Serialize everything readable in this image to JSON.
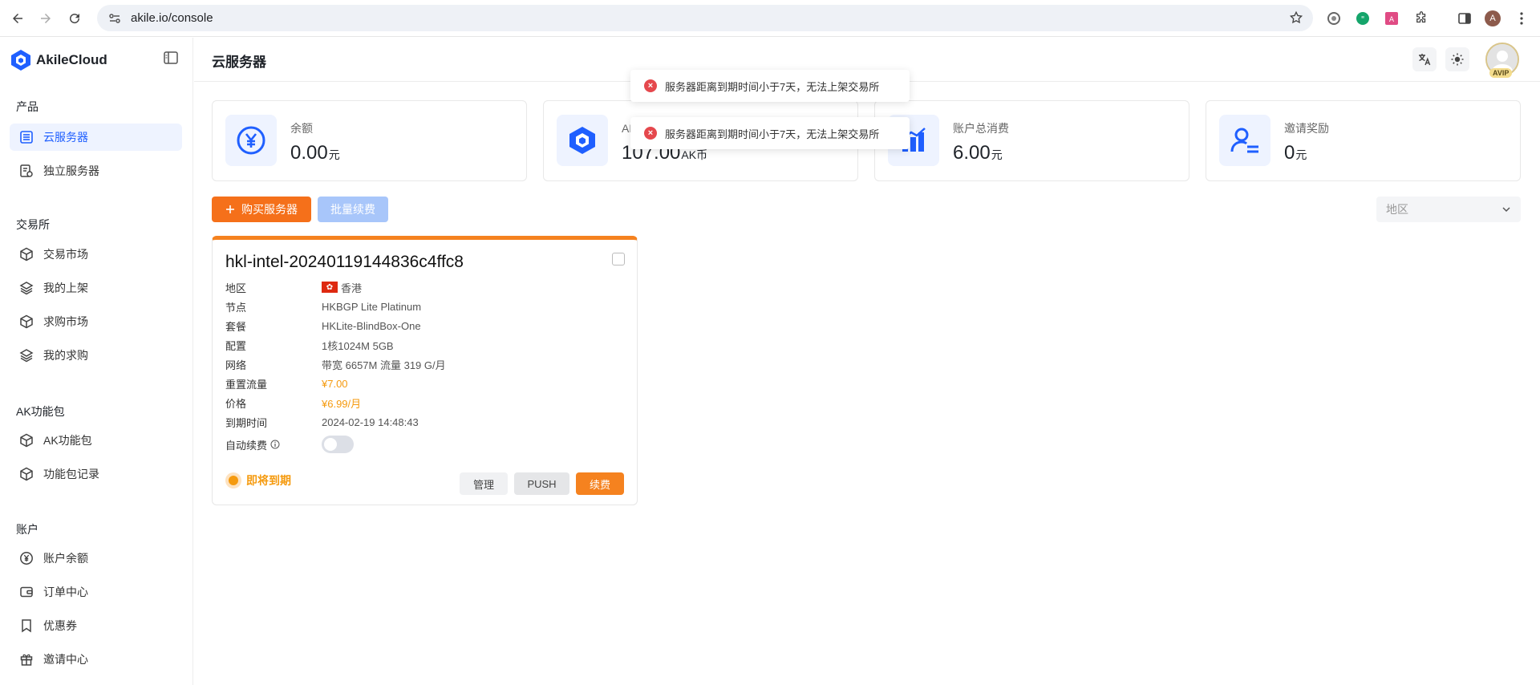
{
  "browser": {
    "url": "akile.io/console",
    "profile_initial": "A"
  },
  "brand": {
    "name": "AkileCloud"
  },
  "sidebar": {
    "sections": [
      {
        "title": "产品",
        "items": [
          {
            "label": "云服务器",
            "icon": "server-list-icon",
            "active": true
          },
          {
            "label": "独立服务器",
            "icon": "dedicated-server-icon"
          }
        ]
      },
      {
        "title": "交易所",
        "items": [
          {
            "label": "交易市场",
            "icon": "cube-icon"
          },
          {
            "label": "我的上架",
            "icon": "layers-icon"
          },
          {
            "label": "求购市场",
            "icon": "cube-icon"
          },
          {
            "label": "我的求购",
            "icon": "layers-icon"
          }
        ]
      },
      {
        "title": "AK功能包",
        "items": [
          {
            "label": "AK功能包",
            "icon": "cube-icon"
          },
          {
            "label": "功能包记录",
            "icon": "cube-icon"
          }
        ]
      },
      {
        "title": "账户",
        "items": [
          {
            "label": "账户余额",
            "icon": "yen-coin-icon"
          },
          {
            "label": "订单中心",
            "icon": "wallet-icon"
          },
          {
            "label": "优惠券",
            "icon": "bookmark-icon"
          },
          {
            "label": "邀请中心",
            "icon": "gift-icon"
          }
        ]
      }
    ]
  },
  "header": {
    "title": "云服务器",
    "badge": "AVIP"
  },
  "stats": [
    {
      "label": "余额",
      "value": "0.00",
      "unit": "元",
      "icon": "yen-icon"
    },
    {
      "label": "AK币",
      "value": "107.00",
      "unit": "AK币",
      "icon": "cube-icon"
    },
    {
      "label": "账户总消费",
      "value": "6.00",
      "unit": "元",
      "icon": "bar-chart-icon"
    },
    {
      "label": "邀请奖励",
      "value": "0",
      "unit": "元",
      "icon": "user-list-icon"
    }
  ],
  "toolbar": {
    "buy_label": "购买服务器",
    "renew_batch_label": "批量续费",
    "region_placeholder": "地区"
  },
  "server": {
    "name": "hkl-intel-20240119144836c4ffc8",
    "rows": [
      {
        "key": "地区",
        "value": "香港",
        "flag": true
      },
      {
        "key": "节点",
        "value": "HKBGP Lite Platinum"
      },
      {
        "key": "套餐",
        "value": "HKLite-BlindBox-One"
      },
      {
        "key": "配置",
        "value": "1核1024M 5GB"
      },
      {
        "key": "网络",
        "value": "带宽 6657M 流量 319 G/月"
      },
      {
        "key": "重置流量",
        "value": "¥7.00",
        "orange": true
      },
      {
        "key": "价格",
        "value": "¥6.99/月",
        "orange": true
      },
      {
        "key": "到期时间",
        "value": "2024-02-19 14:48:43"
      }
    ],
    "auto_renew_label": "自动续费",
    "auto_renew_on": false,
    "status": "即将到期",
    "buttons": {
      "manage": "管理",
      "push": "PUSH",
      "renew": "续费"
    }
  },
  "toasts": [
    "服务器距离到期时间小于7天，无法上架交易所",
    "服务器距离到期时间小于7天，无法上架交易所"
  ],
  "colors": {
    "accent": "#1f5fff",
    "orange": "#f5701a",
    "warning": "#f59a0e",
    "error": "#e5484d"
  }
}
